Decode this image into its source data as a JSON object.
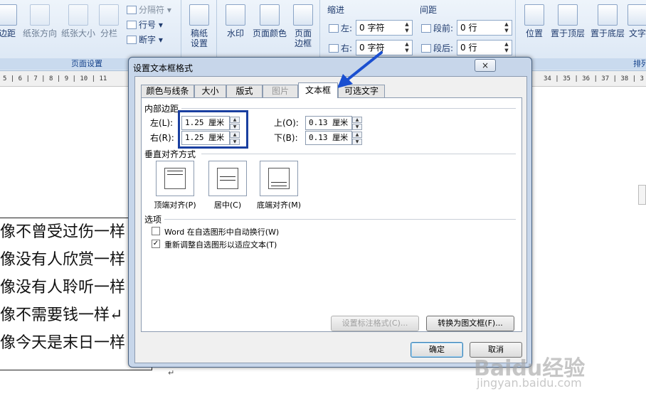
{
  "ribbon": {
    "group_page_setup": {
      "label": "页面设置",
      "margins": "边距",
      "orientation": "纸张方向",
      "size": "纸张大小",
      "columns": "分栏",
      "breaks": "分隔符",
      "line_numbers": "行号",
      "hyphenation": "断字"
    },
    "manuscript": {
      "label": "稿纸设置"
    },
    "page_bg": {
      "watermark": "水印",
      "page_color": "页面颜色",
      "page_border": "页面边框"
    },
    "indent": {
      "title": "缩进",
      "left_label": "左:",
      "left_value": "0 字符",
      "right_label": "右:",
      "right_value": "0 字符"
    },
    "spacing": {
      "title": "间距",
      "before_label": "段前:",
      "before_value": "0 行",
      "after_label": "段后:",
      "after_value": "0 行"
    },
    "arrange": {
      "label": "排列",
      "position": "位置",
      "to_front": "置于顶层",
      "to_back": "置于底层",
      "wrap": "文字"
    }
  },
  "ruler": {
    "left": "5 | 6 | 7 | 8 | 9 | 10 | 11",
    "right": "34 | 35 | 36 | 37 | 38 | 3"
  },
  "document": {
    "lines": [
      "像不曾受过伤一样",
      "像没有人欣赏一样",
      "像没有人聆听一样",
      "像不需要钱一样↵",
      "像今天是末日一样"
    ],
    "mark": "↵"
  },
  "dialog": {
    "title": "设置文本框格式",
    "close": "×",
    "tabs": [
      "颜色与线条",
      "大小",
      "版式",
      "图片",
      "文本框",
      "可选文字"
    ],
    "inner_margin": {
      "title": "内部边距",
      "left_label": "左(L):",
      "left_value": "1.25 厘米",
      "right_label": "右(R):",
      "right_value": "1.25 厘米",
      "top_label": "上(O):",
      "top_value": "0.13 厘米",
      "bottom_label": "下(B):",
      "bottom_value": "0.13 厘米"
    },
    "valign": {
      "title": "垂直对齐方式",
      "top": "顶端对齐(P)",
      "middle": "居中(C)",
      "bottom": "底端对齐(M)"
    },
    "options": {
      "title": "选项",
      "word_wrap": "Word 在自选图形中自动换行(W)",
      "word_wrap_checked": false,
      "resize": "重新调整自选图形以适应文本(T)",
      "resize_checked": true
    },
    "callout_button": "设置标注格式(C)...",
    "convert_button": "转换为图文框(F)...",
    "ok": "确定",
    "cancel": "取消"
  },
  "watermark": {
    "logo": "Baidu经验",
    "url": "jingyan.baidu.com"
  },
  "colors": {
    "highlight": "#1a3fa0",
    "arrow": "#1a4fd0"
  }
}
